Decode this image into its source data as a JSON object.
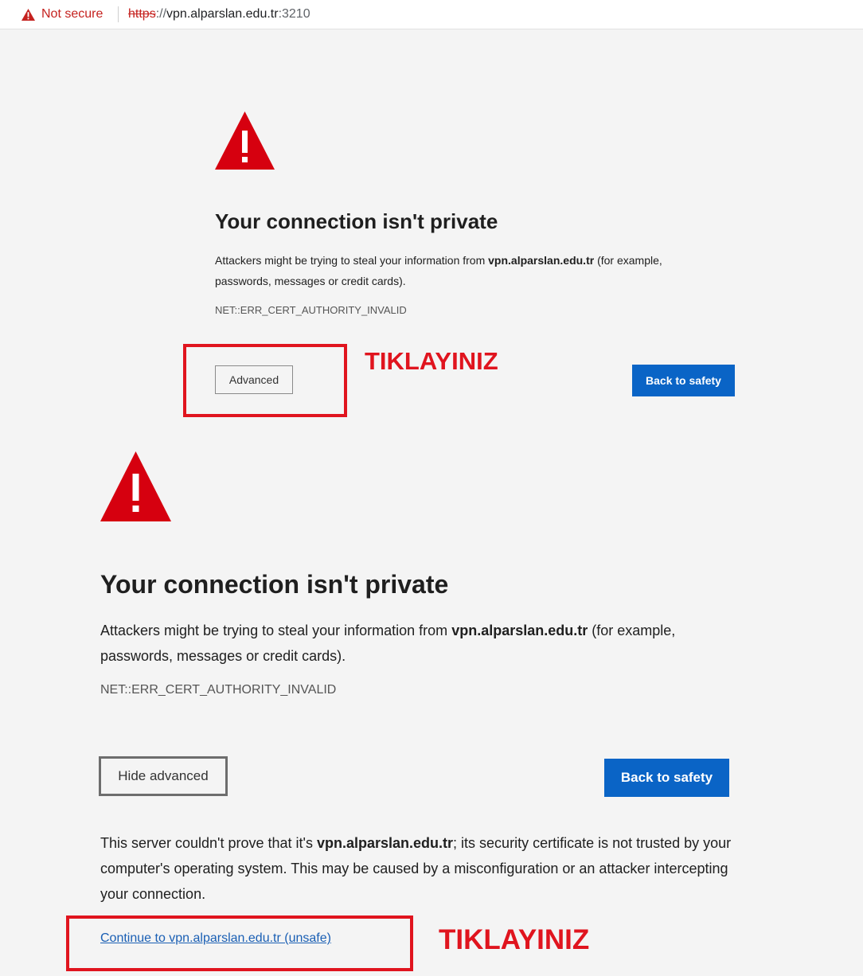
{
  "address_bar": {
    "security_text": "Not secure",
    "url_scheme": "https",
    "url_rest": "://",
    "url_host": "vpn.alparslan.edu.tr",
    "url_port": ":3210"
  },
  "page_before": {
    "heading": "Your connection isn't private",
    "message_prefix": "Attackers might be trying to steal your information from ",
    "message_domain": "vpn.alparslan.edu.tr",
    "message_suffix": " (for example, passwords, messages or credit cards).",
    "error_code": "NET::ERR_CERT_AUTHORITY_INVALID",
    "advanced_button": "Advanced",
    "safety_button": "Back to safety"
  },
  "page_after": {
    "heading": "Your connection isn't private",
    "message_prefix": "Attackers might be trying to steal your information from ",
    "message_domain": "vpn.alparslan.edu.tr",
    "message_suffix": " (for example, passwords, messages or credit cards).",
    "error_code": "NET::ERR_CERT_AUTHORITY_INVALID",
    "hide_advanced_button": "Hide advanced",
    "safety_button": "Back to safety",
    "details_prefix": "This server couldn't prove that it's ",
    "details_domain": "vpn.alparslan.edu.tr",
    "details_suffix": "; its security certificate is not trusted by your computer's operating system. This may be caused by a misconfiguration or an attacker intercepting your connection.",
    "continue_link": "Continue to vpn.alparslan.edu.tr (unsafe)"
  },
  "annotations": {
    "label_1": "TIKLAYINIZ",
    "label_2": "TIKLAYINIZ",
    "highlight_color": "#e0141e"
  },
  "colors": {
    "warning_red": "#c5221f",
    "primary_blue": "#0a64c6",
    "background": "#f4f4f4"
  },
  "icons": {
    "security": "warning-triangle-icon",
    "page_warning": "warning-triangle-icon"
  }
}
